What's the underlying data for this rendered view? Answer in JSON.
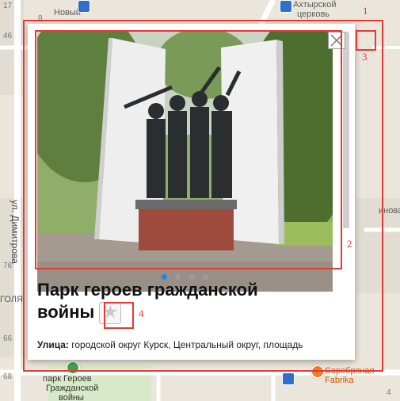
{
  "map": {
    "labels": {
      "novy": "Новый",
      "church_line1": "Ахтырской",
      "church_line2": "церковь",
      "street_dimitrova": "ул. Димитрова",
      "golya": "ГОЛЯ",
      "pinova": "инова",
      "park_line1": "парк Героев",
      "park_line2": "Гражданской",
      "park_line3": "войны",
      "serebryanaya_line1": "Серебряная",
      "serebryanaya_line2": "Fabrika"
    },
    "house_numbers": [
      "17",
      "8",
      "46",
      "76",
      "66",
      "68",
      "4"
    ]
  },
  "card": {
    "photo": {
      "slides_count": 4,
      "active_slide": 1
    },
    "title": "Парк героев гражданской войны",
    "favorite_icon": "star-icon",
    "close_icon": "close-icon",
    "address": {
      "label": "Улица:",
      "value": "городской округ Курск, Центральный округ, площадь"
    }
  },
  "annotations": [
    "1",
    "2",
    "3",
    "4"
  ],
  "colors": {
    "annotation": "#e53935",
    "active_dot": "#1e88e5",
    "park_poi": "#3fa34d"
  }
}
